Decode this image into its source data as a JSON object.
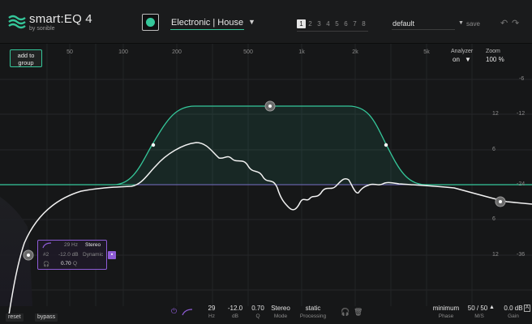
{
  "app": {
    "name": "smart:EQ 4",
    "brand": "by sonible"
  },
  "header": {
    "preset": "Electronic | House",
    "slots": [
      "1",
      "2",
      "3",
      "4",
      "5",
      "6",
      "7",
      "8"
    ],
    "active_slot": "1",
    "setting": "default",
    "save_label": "save"
  },
  "graph": {
    "add_group_label_1": "add to",
    "add_group_label_2": "group",
    "freq_labels": [
      "50",
      "100",
      "200",
      "500",
      "1k",
      "2k",
      "5k"
    ],
    "db_labels_inner": [
      "12",
      "6",
      "6",
      "12"
    ],
    "db_labels_outer": [
      "-6",
      "-12",
      "-24",
      "-36"
    ],
    "analyzer": {
      "title": "Analyzer",
      "value": "on"
    },
    "zoom": {
      "title": "Zoom",
      "value": "100 %"
    }
  },
  "band_panel": {
    "freq": "29 Hz",
    "channel": "Stereo",
    "band": "#2",
    "gain": "-12.0 dB",
    "mode": "Dynamic",
    "q": "0.70",
    "q_label": "Q"
  },
  "footer": {
    "reset_label": "reset",
    "bypass_label": "bypass",
    "hz": {
      "value": "29",
      "label": "Hz"
    },
    "db": {
      "value": "-12.0",
      "label": "dB"
    },
    "q": {
      "value": "0.70",
      "label": "Q"
    },
    "mode": {
      "value": "Stereo",
      "label": "Mode"
    },
    "processing": {
      "value": "static",
      "label": "Processing"
    },
    "phase": {
      "value": "minimum",
      "label": "Phase"
    },
    "ms": {
      "value": "50 / 50",
      "label": "M/S"
    },
    "gain": {
      "value": "0.0 dB",
      "label": "Gain"
    }
  },
  "colors": {
    "accent": "#35c79a",
    "band_purple": "#8e5cd6",
    "background": "#161718"
  }
}
